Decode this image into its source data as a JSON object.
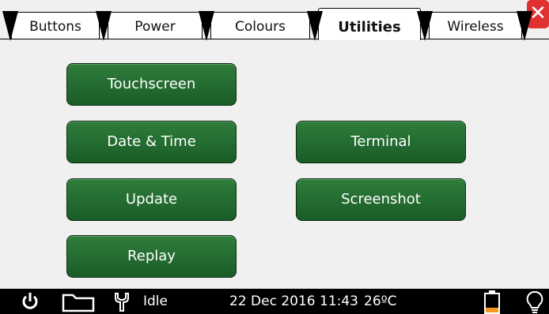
{
  "tabs": [
    {
      "label": "Buttons",
      "active": false
    },
    {
      "label": "Power",
      "active": false
    },
    {
      "label": "Colours",
      "active": false
    },
    {
      "label": "Utilities",
      "active": true
    },
    {
      "label": "Wireless",
      "active": false
    }
  ],
  "close_label": "✕",
  "buttons": {
    "touchscreen": "Touchscreen",
    "date_time": "Date & Time",
    "terminal": "Terminal",
    "update": "Update",
    "screenshot": "Screenshot",
    "replay": "Replay"
  },
  "status": {
    "state": "Idle",
    "datetime": "22 Dec 2016 11:43",
    "temperature": "26ºC"
  },
  "colors": {
    "button_green": "#1f6b2e",
    "close_red": "#e03030",
    "battery_level": "#f39a1e"
  },
  "icons": [
    "power-icon",
    "folder-icon",
    "wrench-icon",
    "battery-icon",
    "lightbulb-icon"
  ],
  "battery_fraction": 0.25
}
